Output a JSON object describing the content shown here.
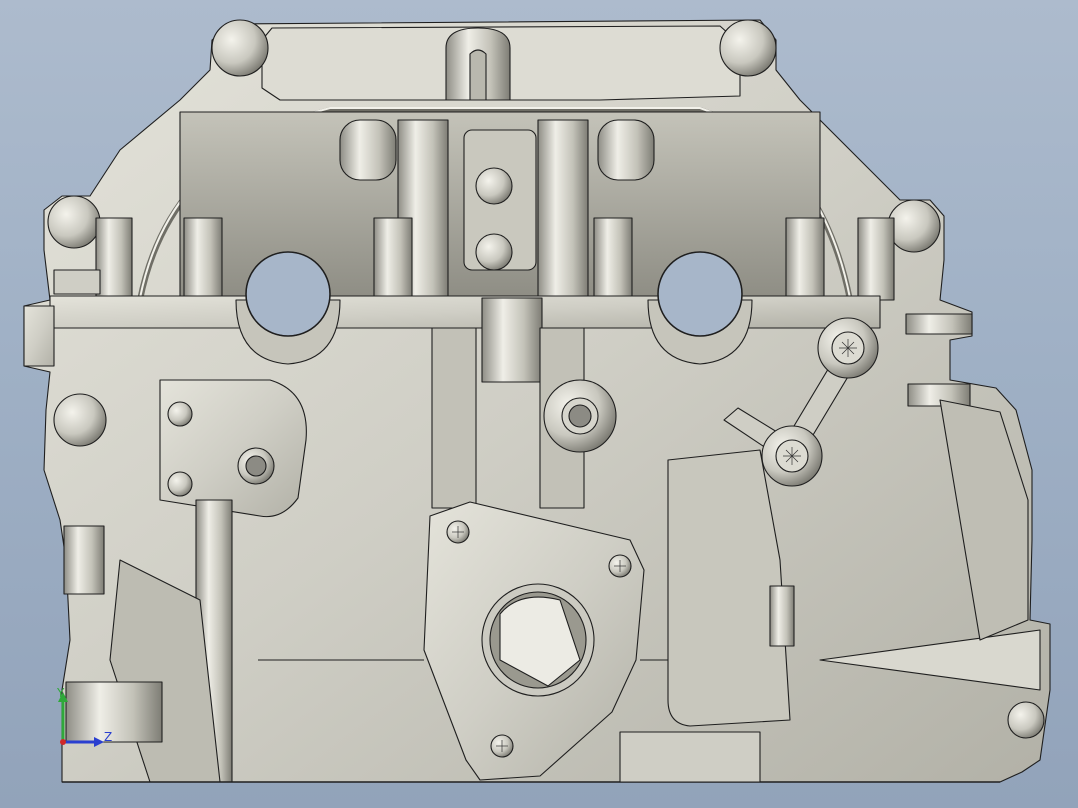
{
  "viewport": {
    "background_top": "#adbbcd",
    "background_bottom": "#92a3ba",
    "model_fill": "#cfcec5",
    "model_shadow": "#8d8c83",
    "edge_color": "#1f1f1f"
  },
  "model": {
    "description_icon": "cylinder-head-model"
  },
  "triad": {
    "y_label": "Y",
    "z_label": "Z",
    "x_color": "#d02828",
    "y_color": "#2fa83a",
    "z_color": "#2a3fd0"
  }
}
